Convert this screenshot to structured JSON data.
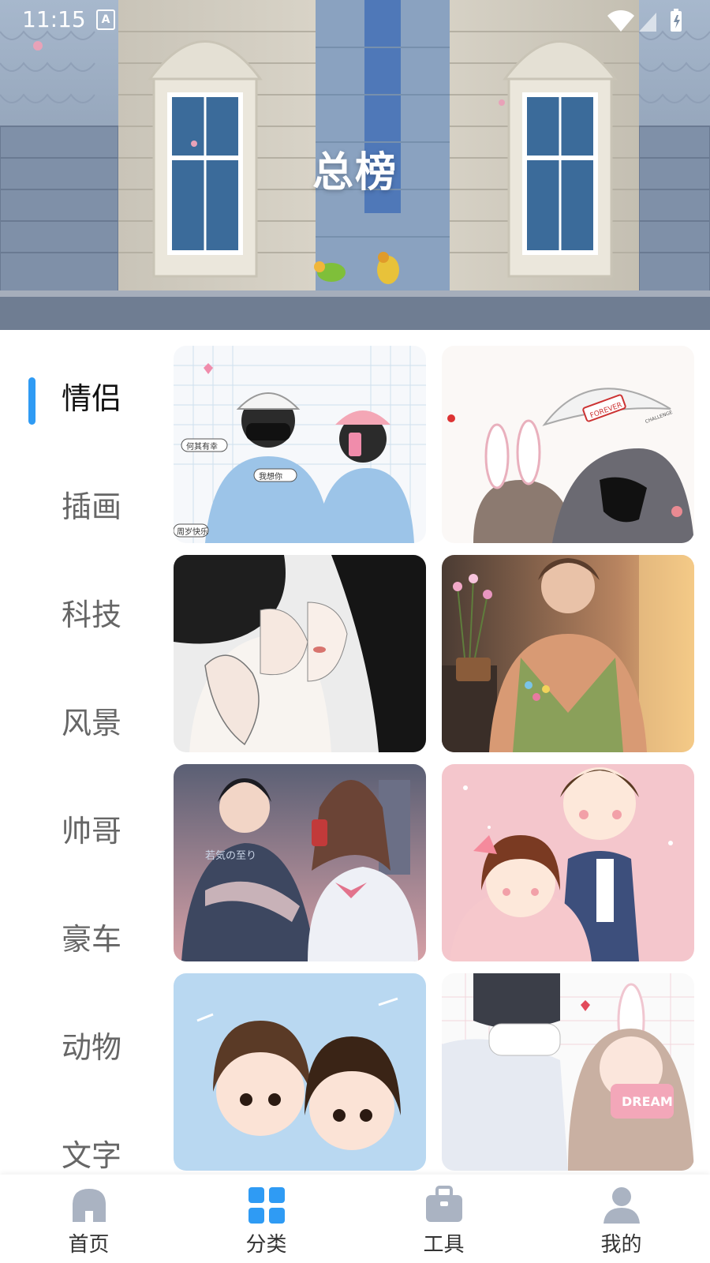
{
  "status_bar": {
    "time": "11:15",
    "notification_glyph": "A"
  },
  "header": {
    "title": "总榜"
  },
  "categories": [
    {
      "label": "情侣",
      "active": true
    },
    {
      "label": "插画",
      "active": false
    },
    {
      "label": "科技",
      "active": false
    },
    {
      "label": "风景",
      "active": false
    },
    {
      "label": "帅哥",
      "active": false
    },
    {
      "label": "豪车",
      "active": false
    },
    {
      "label": "动物",
      "active": false
    },
    {
      "label": "文字",
      "active": false
    }
  ],
  "wallpapers": [
    {
      "tag": "何其有幸",
      "sub": "我想你",
      "foot": "周岁快乐"
    },
    {
      "tag": "FOREVER",
      "sub": "CHALLENGE"
    },
    {
      "tag": ""
    },
    {
      "tag": ""
    },
    {
      "tag": "若気の至り"
    },
    {
      "tag": ""
    },
    {
      "tag": ""
    },
    {
      "tag": "DREAM"
    }
  ],
  "bottom_nav": [
    {
      "label": "首页",
      "icon": "home-icon",
      "active": false
    },
    {
      "label": "分类",
      "icon": "grid-icon",
      "active": true
    },
    {
      "label": "工具",
      "icon": "toolbox-icon",
      "active": false
    },
    {
      "label": "我的",
      "icon": "person-icon",
      "active": false
    }
  ],
  "colors": {
    "accent": "#2f9bf4",
    "inactive_icon": "#aab3c2",
    "text_inactive": "#666666",
    "text_active": "#111111"
  }
}
